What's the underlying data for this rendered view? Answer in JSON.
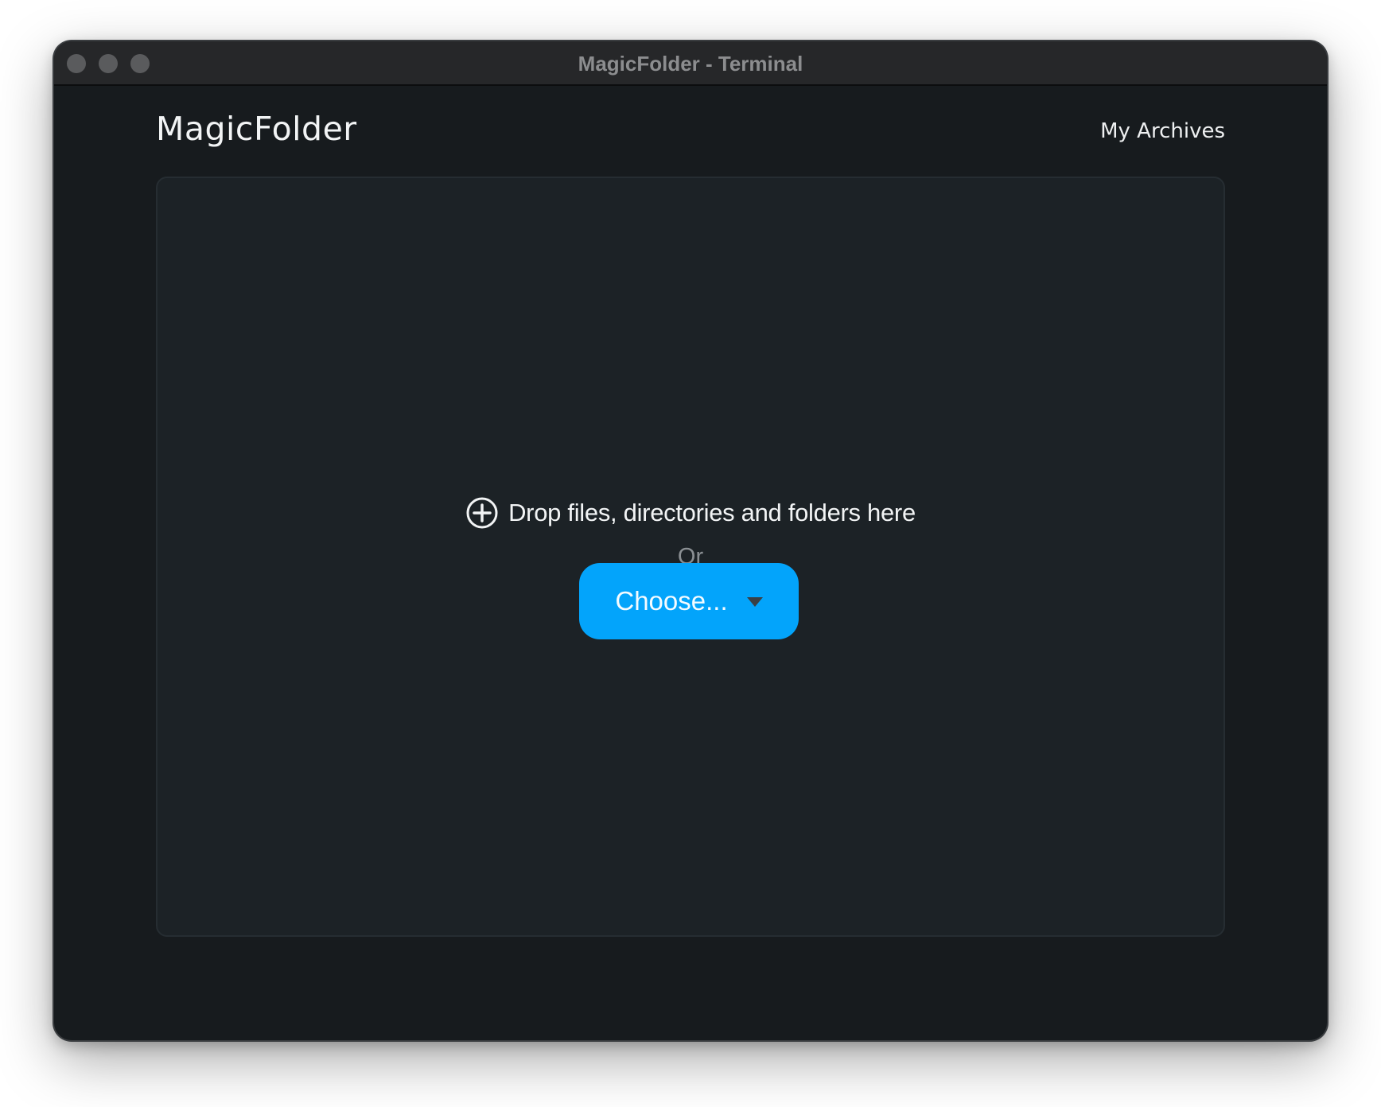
{
  "window": {
    "title": "MagicFolder - Terminal"
  },
  "header": {
    "app_title": "MagicFolder",
    "archives_link": "My Archives"
  },
  "dropzone": {
    "icon": "plus-circle-icon",
    "prompt": "Drop files, directories and folders here",
    "or_label": "Or",
    "choose_label": "Choose...",
    "choose_icon": "chevron-down-icon"
  },
  "colors": {
    "window_bg": "#171b1e",
    "titlebar_bg": "#262729",
    "dropzone_bg": "#1c2226",
    "accent": "#03a4fb",
    "text_primary": "#f2f4f5",
    "text_muted": "#8a8f93"
  }
}
